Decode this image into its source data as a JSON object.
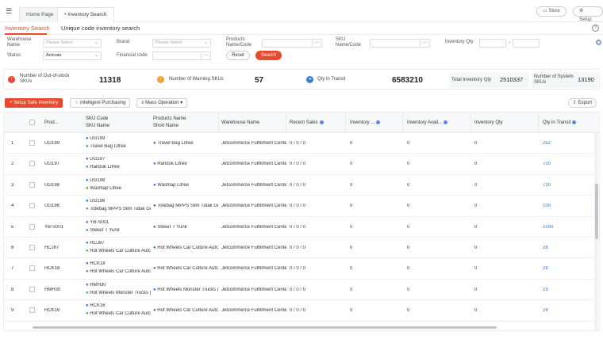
{
  "topbar": {
    "tabs": [
      "Home Page",
      "Inventory Search"
    ],
    "close_glyph": "×",
    "store_label": "Store",
    "setup_label": "Setup"
  },
  "subtabs": [
    "Inventory Search",
    "Unique code inventory search"
  ],
  "filters": {
    "warehouse_name_label": "Warehouse Name",
    "warehouse_placeholder": "Please Select",
    "brand_label": "Brand",
    "brand_placeholder": "Please Select",
    "products_name_code_label": "Products Name/Code",
    "sku_name_code_label": "SKU Name/Code",
    "inventory_qty_label": "Inventory Qty",
    "range_sep": "-",
    "status_label": "Status",
    "status_value": "Activate",
    "financial_code_label": "Financial code",
    "reset_label": "Reset",
    "search_label": "Search",
    "more_glyph": "..."
  },
  "stats": {
    "out_of_stock_label": "Number of Out-of-stock SKUs",
    "out_of_stock_value": "11318",
    "warning_label": "Number of Warning SKUs",
    "warning_value": "57",
    "transit_label": "Qty in Transit",
    "transit_value": "6583210",
    "total_inventory_label": "Total Inventory Qty",
    "total_inventory_value": "2510337",
    "system_skus_label": "Number of System SKUs",
    "system_skus_value": "13190"
  },
  "actions": {
    "setup_safe_label": "+ Setup Safe Inventory",
    "intelligent_purchasing_label": "Intelligent Purchasing",
    "mass_operation_label": "Mass Operation",
    "export_label": "Export"
  },
  "table": {
    "headers": {
      "product": "Prod...",
      "sku_code": "SKU Code",
      "sku_name": "SKU Name",
      "products_name": "Products Name",
      "short_name": "Short Name",
      "warehouse_name": "Warehouse Name",
      "recent_sales": "Recent Sales",
      "inventory": "Inventory ...",
      "inventory_avail": "Inventory Avail...",
      "inventory_qty": "Inventory Qty",
      "qty_in_transit": "Qty in Transit"
    },
    "rows": [
      {
        "no": "1",
        "product": "UG199",
        "sku_code": "UG199",
        "sku_name": "Travel Bag Lifree",
        "short_name": "Travel Bag Lifree",
        "warehouse": "Jetcommerce Fulfillment Cente",
        "sales": "0 / 0 / 0",
        "inv": "0",
        "avail": "0",
        "qty": "0",
        "transit": "252"
      },
      {
        "no": "2",
        "product": "UG197",
        "sku_code": "UG197",
        "sku_name": "Handuk Lifree",
        "short_name": "Handuk Lifree",
        "warehouse": "Jetcommerce Fulfillment Cente",
        "sales": "0 / 0 / 0",
        "inv": "0",
        "avail": "0",
        "qty": "0",
        "transit": "720"
      },
      {
        "no": "3",
        "product": "UG198",
        "sku_code": "UG198",
        "sku_name": "Washlap Lifree",
        "short_name": "Washlap Lifree",
        "warehouse": "Jetcommerce Fulfillment Cente",
        "sales": "0 / 0 / 0",
        "inv": "0",
        "avail": "0",
        "qty": "0",
        "transit": "720"
      },
      {
        "no": "4",
        "product": "UG196",
        "sku_code": "UG196",
        "sku_name": "Totebag MPPS Slim Tidak Ge",
        "short_name": "Totebag MPPS Slim Tidak Ge",
        "warehouse": "Jetcommerce Fulfillment Cente",
        "sales": "0 / 0 / 0",
        "inv": "0",
        "avail": "0",
        "qty": "0",
        "transit": "100"
      },
      {
        "no": "5",
        "product": "YB-S001",
        "sku_code": "YB-S001",
        "sku_name": "Steker T Yunir",
        "short_name": "Steker T Yunir",
        "warehouse": "Jetcommerce Fulfillment Cente",
        "sales": "0 / 0 / 0",
        "inv": "0",
        "avail": "0",
        "qty": "0",
        "transit": "1000"
      },
      {
        "no": "6",
        "product": "HCJ87",
        "sku_code": "HCJ87",
        "sku_name": "Hot Wheels Car Culture Autc",
        "short_name": "Hot Wheels Car Culture Autc",
        "warehouse": "Jetcommerce Fulfillment Cente",
        "sales": "0 / 0 / 0",
        "inv": "0",
        "avail": "0",
        "qty": "0",
        "transit": "28"
      },
      {
        "no": "7",
        "product": "HCK18",
        "sku_code": "HCK18",
        "sku_name": "Hot Wheels Car Culture Autc",
        "short_name": "Hot Wheels Car Culture Autc",
        "warehouse": "Jetcommerce Fulfillment Cente",
        "sales": "0 / 0 / 0",
        "inv": "0",
        "avail": "0",
        "qty": "0",
        "transit": "28"
      },
      {
        "no": "8",
        "product": "HMH30",
        "sku_code": "HMH30",
        "sku_name": "Hot Wheels Monster Trucks (",
        "short_name": "Hot Wheels Monster Trucks (",
        "warehouse": "Jetcommerce Fulfillment Cente",
        "sales": "0 / 0 / 0",
        "inv": "0",
        "avail": "0",
        "qty": "0",
        "transit": "19"
      },
      {
        "no": "9",
        "product": "HCK16",
        "sku_code": "HCK16",
        "sku_name": "Hot Wheels Car Culture Autc",
        "short_name": "Hot Wheels Car Culture Autc",
        "warehouse": "Jetcommerce Fulfillment Cente",
        "sales": "0 / 0 / 0",
        "inv": "0",
        "avail": "0",
        "qty": "0",
        "transit": "28"
      }
    ]
  },
  "colors": {
    "accent": "#e84a2f",
    "link": "#2f6fd6",
    "green": "#3aa55a"
  }
}
